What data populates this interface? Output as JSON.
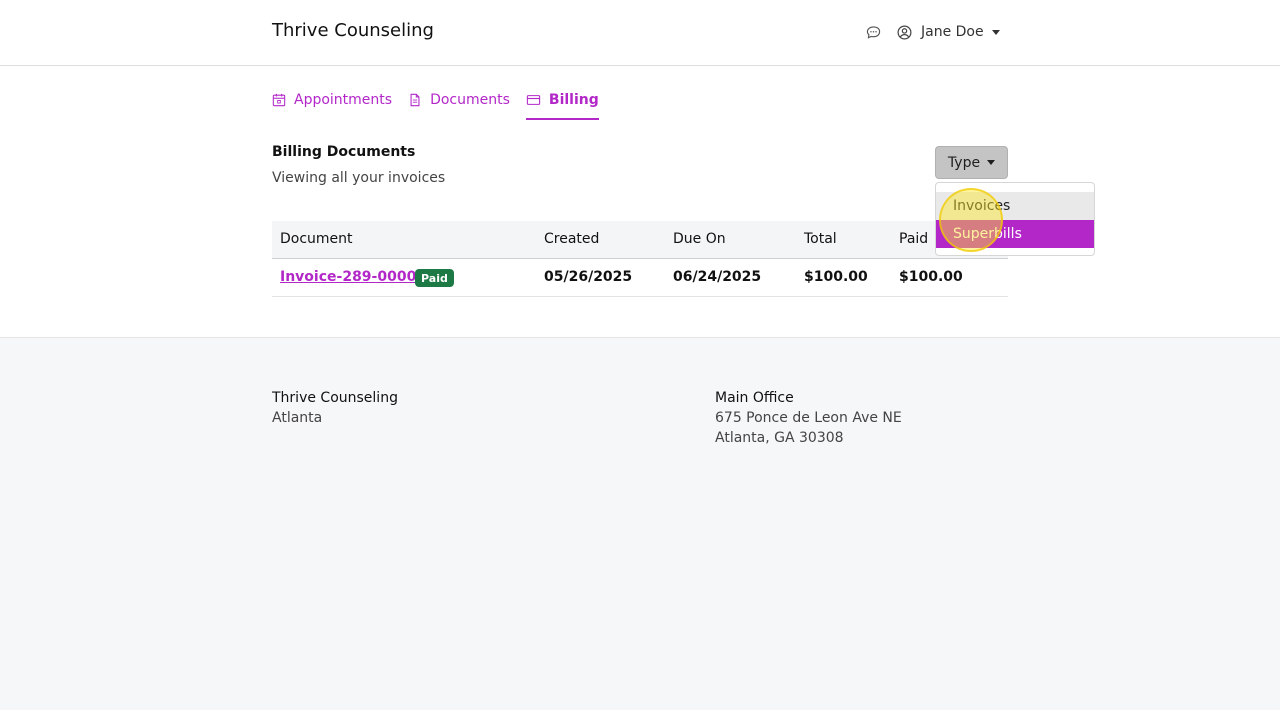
{
  "header": {
    "brand": "Thrive Counseling",
    "user_name": "Jane Doe"
  },
  "tabs": [
    {
      "label": "Appointments",
      "icon": "calendar-icon",
      "active": false
    },
    {
      "label": "Documents",
      "icon": "document-icon",
      "active": false
    },
    {
      "label": "Billing",
      "icon": "credit-card-icon",
      "active": true
    }
  ],
  "section": {
    "title": "Billing Documents",
    "subtitle": "Viewing all your invoices"
  },
  "type_filter": {
    "label": "Type",
    "options": [
      "Invoices",
      "Superbills"
    ],
    "hovered": "Invoices",
    "highlighted": "Superbills"
  },
  "table": {
    "columns": [
      "Document",
      "Created",
      "Due On",
      "Total",
      "Paid"
    ],
    "rows": [
      {
        "document": "Invoice-289-00001",
        "status": "Paid",
        "created": "05/26/2025",
        "due_on": "06/24/2025",
        "total": "$100.00",
        "paid": "$100.00"
      }
    ]
  },
  "footer": {
    "left": {
      "title": "Thrive Counseling",
      "line1": "Atlanta"
    },
    "right": {
      "title": "Main Office",
      "line1": "675 Ponce de Leon Ave NE",
      "line2": "Atlanta, GA 30308"
    }
  },
  "colors": {
    "accent": "#b327c9",
    "paid_badge": "#1e7a45",
    "footer_bg": "#f6f7f9"
  }
}
